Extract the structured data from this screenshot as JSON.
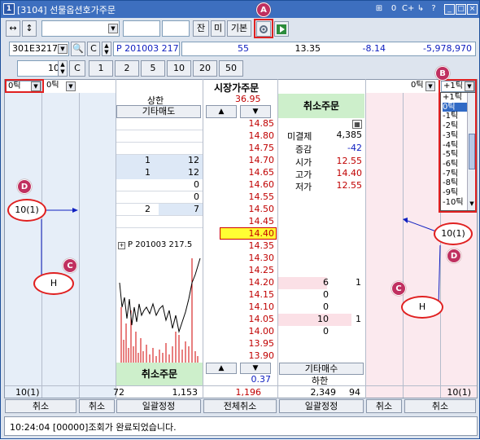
{
  "window": {
    "title": "[3104] 선물옵션호가주문",
    "title_icon": "1",
    "controls": [
      "⊞",
      "0",
      "C+",
      "↳",
      "?",
      "≡"
    ]
  },
  "toolbar": {
    "arrows": [
      "↔",
      "↕"
    ],
    "buttons": [
      "잔",
      "미",
      "기본"
    ],
    "gear_icon": "gear-icon",
    "play_icon": "play-icon"
  },
  "code_row": {
    "code": "301E3217",
    "c_label": "C",
    "name": "P 201003 217",
    "v1": "55",
    "v2": "13.35",
    "v3": "-8.14",
    "v4": "-5,978,970"
  },
  "qty_row": {
    "qty": "10",
    "c_label": "C",
    "presets": [
      "1",
      "2",
      "5",
      "10",
      "20",
      "50"
    ]
  },
  "ladder_header": {
    "left_tick1": "0틱",
    "left_tick2": "0틱",
    "title": "시장가주문",
    "right_tick1": "0틱",
    "right_tick2": "+1틱"
  },
  "upper_limit": {
    "label": "상한",
    "value": "36.95"
  },
  "other_sell": "기타매도",
  "cancel_order": "취소주문",
  "up_arrow": "▲",
  "down_arrow": "▼",
  "prices": [
    "14.85",
    "14.80",
    "14.75",
    "14.70",
    "14.65",
    "14.60",
    "14.55",
    "14.50",
    "14.45",
    "14.40",
    "14.35",
    "14.30",
    "14.25",
    "14.20",
    "14.15",
    "14.10",
    "14.05",
    "14.00",
    "13.95",
    "13.90"
  ],
  "ask_rows": [
    {
      "cnt": "",
      "qty": ""
    },
    {
      "cnt": "",
      "qty": ""
    },
    {
      "cnt": "",
      "qty": ""
    },
    {
      "cnt": "1",
      "qty": "12"
    },
    {
      "cnt": "1",
      "qty": "12"
    },
    {
      "cnt": "",
      "qty": "0"
    },
    {
      "cnt": "",
      "qty": "0"
    },
    {
      "cnt": "2",
      "qty": "7"
    },
    {
      "cnt": "",
      "qty": ""
    }
  ],
  "bid_rows": [
    {
      "qty": "6",
      "cnt": "1"
    },
    {
      "qty": "0",
      "cnt": ""
    },
    {
      "qty": "0",
      "cnt": ""
    },
    {
      "qty": "10",
      "cnt": "1"
    },
    {
      "qty": "0",
      "cnt": ""
    }
  ],
  "info": {
    "open_interest_label": "미결제",
    "open_interest": "4,385",
    "change_label": "증감",
    "change": "-42",
    "open_label": "시가",
    "open": "12.55",
    "high_label": "고가",
    "high": "14.40",
    "low_label": "저가",
    "low": "12.55"
  },
  "mini_chart": {
    "label": "P 201003 217.5"
  },
  "bottom": {
    "cancel_order": "취소주문",
    "other_buy": "기타매수",
    "lower_limit_label": "하한",
    "value_037": "0.37",
    "sum_left1": "72",
    "sum_left2": "1,153",
    "sum_mid": "1,196",
    "sum_right1": "2,349",
    "sum_right2": "94",
    "left_pos": "10(1)",
    "right_pos": "10(1)"
  },
  "action_bar": [
    "취소",
    "취소",
    "일괄정정",
    "전체취소",
    "일괄정정",
    "취소",
    "취소"
  ],
  "status": "10:24:04  [00000]조회가 완료되었습니다.",
  "dropdown_options": [
    "+1틱",
    "0틱",
    "-1틱",
    "-2틱",
    "-3틱",
    "-4틱",
    "-5틱",
    "-6틱",
    "-7틱",
    "-8틱",
    "-9틱",
    "-10틱"
  ],
  "annotations": {
    "A": "A",
    "B": "B",
    "C": "C",
    "D": "D",
    "left_pos_ann": "10(1)",
    "right_pos_ann": "10(1)",
    "H_left": "H",
    "H_right": "H"
  },
  "colors": {
    "title_bg": "#3d6fbf",
    "ask_bg": "#e6eef8",
    "bid_bg": "#fbe9ee",
    "info_green": "#cdefcb",
    "price_red": "#c00000",
    "highlight_yellow": "#ffff33",
    "annotation_red": "#e02020",
    "badge": "#c03060"
  }
}
